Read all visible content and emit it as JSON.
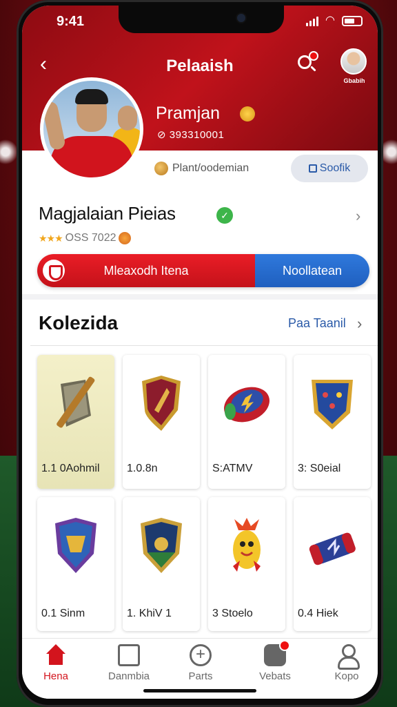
{
  "status": {
    "time": "9:41"
  },
  "header": {
    "title": "Pelaaish",
    "avatar_label": "Gbabih"
  },
  "profile": {
    "name": "Pramjan",
    "id_text": "⊘ 393310001",
    "role": "Plant/oodemian",
    "follow_label": "Soofik"
  },
  "club": {
    "name": "Magjalaian Pieias",
    "stars": "★★★",
    "rating_text": "OSS 7022"
  },
  "segment": {
    "left_label": "Mleaxodh Itena",
    "right_label": "Noollatean"
  },
  "collection": {
    "title": "Kolezida",
    "link_label": "Paa Taanil",
    "items": [
      {
        "label": "1.1 0Aohmil"
      },
      {
        "label": "1.0.8n"
      },
      {
        "label": "S:ATMV"
      },
      {
        "label": "3: S0eial"
      },
      {
        "label": "0.1 Sinm"
      },
      {
        "label": "1. KhiV 1"
      },
      {
        "label": "3 Stoelo"
      },
      {
        "label": "0.4 Hiek"
      }
    ]
  },
  "tabs": [
    {
      "label": "Hena"
    },
    {
      "label": "Danmbia"
    },
    {
      "label": "Parts"
    },
    {
      "label": "Vebats"
    },
    {
      "label": "Kopo"
    }
  ],
  "colors": {
    "brand_red": "#d3141d",
    "accent_blue": "#2a5aa8"
  }
}
